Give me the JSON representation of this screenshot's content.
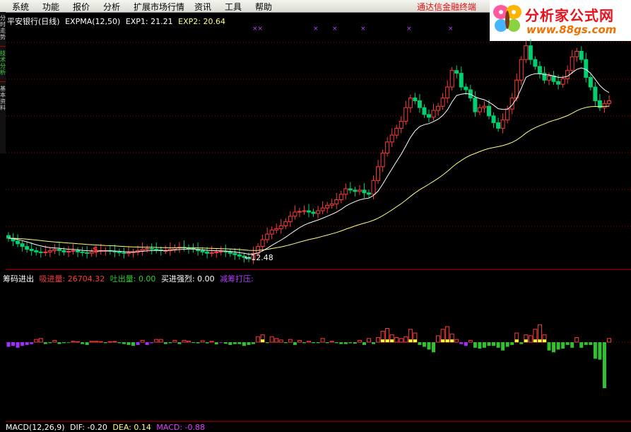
{
  "menu": [
    "系统",
    "功能",
    "报价",
    "分析",
    "扩展市场行情",
    "资讯",
    "工具",
    "帮助"
  ],
  "broker_link": "通达信金融终端",
  "logo": {
    "brand": "分析家公式网",
    "url": "www.88gs.com"
  },
  "side_tabs": [
    "分时走势",
    "技术分析",
    "基本资料"
  ],
  "main_panel": {
    "stock_title": "平安银行(日线)",
    "indicator": "EXPMA(12,50)",
    "exp1_label": "EXP1:",
    "exp1_value": "21.21",
    "exp2_label": "EXP2:",
    "exp2_value": "20.64",
    "low_annotation": "←12.48",
    "signal_marker": "$",
    "x_markers": [
      "××",
      "×",
      "×",
      "×",
      "×",
      "×"
    ]
  },
  "chip_panel": {
    "title": "筹码进出",
    "absorb_label": "吸进量:",
    "absorb_value": "26704.32",
    "spit_label": "吐出量:",
    "spit_value": "0.00",
    "buy_label": "买进强烈:",
    "buy_value": "0.00",
    "press_label": "减筹打压:"
  },
  "macd_panel": {
    "indicator": "MACD(12,26,9)",
    "dif_label": "DIF:",
    "dif_value": "-0.20",
    "dea_label": "DEA:",
    "dea_value": "0.14",
    "macd_label": "MACD:",
    "macd_value": "-0.88"
  },
  "colors": {
    "up": "#ff3c3c",
    "down": "#00d070",
    "exp1": "#ffffff",
    "exp2": "#ffff80",
    "chip_red": "#ff3c3c",
    "chip_yellow": "#ffff40",
    "chip_green": "#30c030",
    "chip_purple": "#a030ff",
    "grid": "#a00000"
  },
  "chart_data": {
    "type": "candlestick",
    "close": [
      14.0,
      13.8,
      13.6,
      13.4,
      13.2,
      13.1,
      13.0,
      12.95,
      13.0,
      13.1,
      13.2,
      13.1,
      13.0,
      13.05,
      13.1,
      13.0,
      12.95,
      12.9,
      13.0,
      13.05,
      13.1,
      13.1,
      13.05,
      13.0,
      12.95,
      12.9,
      12.95,
      13.0,
      13.1,
      13.2,
      13.25,
      13.2,
      13.15,
      13.1,
      13.1,
      13.2,
      13.3,
      13.35,
      13.3,
      13.25,
      13.2,
      13.1,
      13.0,
      12.9,
      12.95,
      13.0,
      13.05,
      13.0,
      12.9,
      12.8,
      12.7,
      12.6,
      12.5,
      12.9,
      13.4,
      13.9,
      14.3,
      14.6,
      14.7,
      14.9,
      15.2,
      15.6,
      15.9,
      15.95,
      16.0,
      15.9,
      15.8,
      16.0,
      16.2,
      16.4,
      16.5,
      16.8,
      17.2,
      17.6,
      17.5,
      17.4,
      17.5,
      17.3,
      17.2,
      18.2,
      19.2,
      20.2,
      21.0,
      21.5,
      22.0,
      22.5,
      23.5,
      24.2,
      24.0,
      23.5,
      23.0,
      22.8,
      23.3,
      23.6,
      24.2,
      25.0,
      26.2,
      26.0,
      25.0,
      24.8,
      24.2,
      23.2,
      23.5,
      23.6,
      22.9,
      22.4,
      22.0,
      22.6,
      23.4,
      24.2,
      25.5,
      27.0,
      28.0,
      27.0,
      26.5,
      26.0,
      25.5,
      25.8,
      25.4,
      25.2,
      25.6,
      26.2,
      27.2,
      27.6,
      27.0,
      25.7,
      25.0,
      24.0,
      23.5,
      23.8,
      24.0
    ],
    "exp1": [
      14.0,
      13.97,
      13.91,
      13.83,
      13.73,
      13.63,
      13.53,
      13.44,
      13.37,
      13.32,
      13.3,
      13.27,
      13.23,
      13.2,
      13.19,
      13.16,
      13.12,
      13.09,
      13.08,
      13.07,
      13.08,
      13.08,
      13.08,
      13.07,
      13.05,
      13.02,
      13.01,
      13.01,
      13.02,
      13.05,
      13.08,
      13.1,
      13.11,
      13.11,
      13.11,
      13.12,
      13.15,
      13.18,
      13.2,
      13.21,
      13.21,
      13.19,
      13.16,
      13.12,
      13.1,
      13.09,
      13.08,
      13.07,
      13.04,
      13.0,
      12.95,
      12.9,
      12.84,
      12.85,
      12.93,
      13.08,
      13.27,
      13.48,
      13.68,
      13.87,
      14.08,
      14.31,
      14.55,
      14.77,
      14.96,
      15.1,
      15.21,
      15.33,
      15.46,
      15.6,
      15.74,
      15.9,
      16.1,
      16.33,
      16.51,
      16.66,
      16.79,
      16.87,
      16.92,
      17.11,
      17.43,
      17.93,
      18.5,
      19.04,
      19.58,
      20.11,
      20.71,
      21.33,
      21.81,
      22.12,
      22.26,
      22.34,
      22.49,
      22.66,
      22.93,
      23.33,
      23.92,
      24.38,
      24.48,
      24.53,
      24.48,
      24.28,
      24.16,
      24.07,
      23.9,
      23.68,
      23.42,
      23.37,
      23.38,
      23.68,
      24.17,
      24.91,
      25.7,
      25.87,
      25.97,
      25.97,
      25.9,
      25.88,
      25.8,
      25.7,
      25.7,
      25.78,
      26.04,
      26.28,
      26.39,
      26.28,
      26.0,
      25.56,
      25.11,
      24.79,
      24.59
    ],
    "exp2": [
      14.0,
      13.99,
      13.98,
      13.96,
      13.93,
      13.9,
      13.87,
      13.83,
      13.79,
      13.76,
      13.73,
      13.71,
      13.68,
      13.65,
      13.63,
      13.6,
      13.58,
      13.55,
      13.53,
      13.51,
      13.49,
      13.47,
      13.46,
      13.44,
      13.42,
      13.4,
      13.38,
      13.37,
      13.36,
      13.35,
      13.35,
      13.34,
      13.33,
      13.32,
      13.32,
      13.31,
      13.31,
      13.31,
      13.31,
      13.31,
      13.31,
      13.3,
      13.29,
      13.27,
      13.26,
      13.25,
      13.24,
      13.23,
      13.22,
      13.2,
      13.18,
      13.15,
      13.12,
      13.11,
      13.12,
      13.15,
      13.19,
      13.25,
      13.31,
      13.37,
      13.44,
      13.53,
      13.62,
      13.72,
      13.81,
      13.9,
      13.97,
      14.05,
      14.14,
      14.23,
      14.32,
      14.42,
      14.53,
      14.66,
      14.77,
      14.89,
      15.0,
      15.1,
      15.19,
      15.31,
      15.46,
      15.64,
      15.85,
      16.06,
      16.29,
      16.51,
      16.77,
      17.04,
      17.3,
      17.53,
      17.73,
      17.93,
      18.14,
      18.36,
      18.6,
      18.86,
      19.16,
      19.43,
      19.66,
      19.87,
      20.04,
      20.17,
      20.3,
      20.43,
      20.53,
      20.6,
      20.66,
      20.74,
      20.84,
      20.97,
      21.15,
      21.38,
      21.65,
      21.86,
      22.04,
      22.19,
      22.32,
      22.46,
      22.57,
      22.67,
      22.79,
      22.92,
      23.09,
      23.27,
      23.42,
      23.51,
      23.57,
      23.59,
      23.58,
      23.59,
      23.61
    ],
    "chip": [
      -2.5,
      -2.0,
      -3.0,
      -2.0,
      -1.5,
      -1.0,
      1.5,
      2.0,
      -1.0,
      -0.5,
      1.0,
      -1.0,
      -0.5,
      -0.3,
      0.5,
      0.3,
      -1.0,
      -1.5,
      0.5,
      0.5,
      0.3,
      -0.5,
      0.3,
      0.4,
      -0.5,
      -1.0,
      -1.5,
      -2.0,
      -1.5,
      1.0,
      -1.5,
      -0.5,
      1.5,
      1.5,
      -1.0,
      -0.5,
      1.0,
      -1.0,
      1.0,
      0.6,
      -0.4,
      -0.6,
      0.8,
      -0.6,
      0.5,
      -1.2,
      -0.3,
      -0.8,
      -1.5,
      -1.0,
      -1.0,
      -2.0,
      -1.5,
      -1.0,
      3.0,
      4.0,
      -0.5,
      3.0,
      2.0,
      1.2,
      -0.5,
      1.5,
      -1.5,
      1.0,
      -0.5,
      0.5,
      -0.5,
      -0.5,
      2.0,
      -0.5,
      0.5,
      -0.5,
      -1.0,
      -1.0,
      -0.5,
      -0.8,
      1.0,
      -1.5,
      2.0,
      -1.0,
      2.5,
      6.0,
      7.5,
      4.0,
      2.5,
      2.0,
      3.0,
      7.0,
      5.0,
      -1.5,
      -2.5,
      -4.0,
      -5.5,
      3.5,
      7.0,
      8.5,
      4.5,
      1.5,
      -1.0,
      -2.0,
      1.0,
      -3.0,
      -3.5,
      -3.0,
      -2.0,
      -2.0,
      -3.0,
      -4.5,
      -2.5,
      -1.5,
      5.0,
      -1.0,
      4.0,
      3.5,
      7.0,
      9.5,
      4.0,
      -4.5,
      -5.5,
      -4.0,
      -3.5,
      -1.5,
      -3.0,
      2.5,
      -3.0,
      -1.5,
      -1.5,
      -9.0,
      -9.5,
      -25.0,
      2.0,
      1.5,
      0.8,
      1.0
    ]
  }
}
